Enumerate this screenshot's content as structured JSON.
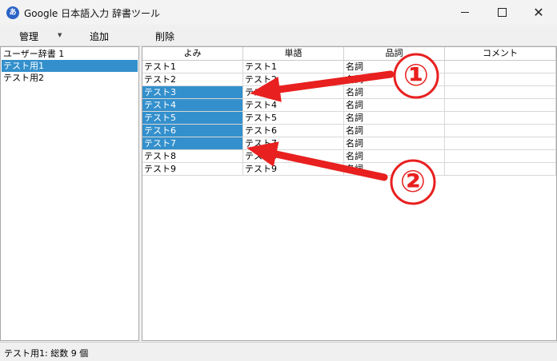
{
  "window": {
    "title": "Google 日本語入力 辞書ツール",
    "icon_label": "あ"
  },
  "menu": {
    "manage": "管理",
    "add": "追加",
    "delete": "削除"
  },
  "dictionaries": [
    {
      "label": "ユーザー辞書 1",
      "selected": false
    },
    {
      "label": "テスト用1",
      "selected": true
    },
    {
      "label": "テスト用2",
      "selected": false
    }
  ],
  "table": {
    "columns": [
      "よみ",
      "単語",
      "品詞",
      "コメント"
    ],
    "rows": [
      {
        "reading": "テスト1",
        "word": "テスト1",
        "pos": "名詞",
        "comment": "",
        "selected": false
      },
      {
        "reading": "テスト2",
        "word": "テスト2",
        "pos": "名詞",
        "comment": "",
        "selected": false
      },
      {
        "reading": "テスト3",
        "word": "テスト3",
        "pos": "名詞",
        "comment": "",
        "selected": true
      },
      {
        "reading": "テスト4",
        "word": "テスト4",
        "pos": "名詞",
        "comment": "",
        "selected": true
      },
      {
        "reading": "テスト5",
        "word": "テスト5",
        "pos": "名詞",
        "comment": "",
        "selected": true
      },
      {
        "reading": "テスト6",
        "word": "テスト6",
        "pos": "名詞",
        "comment": "",
        "selected": true
      },
      {
        "reading": "テスト7",
        "word": "テスト7",
        "pos": "名詞",
        "comment": "",
        "selected": true
      },
      {
        "reading": "テスト8",
        "word": "テスト8",
        "pos": "名詞",
        "comment": "",
        "selected": false
      },
      {
        "reading": "テスト9",
        "word": "テスト9",
        "pos": "名詞",
        "comment": "",
        "selected": false
      }
    ]
  },
  "status": {
    "text": "テスト用1: 総数 9 個"
  },
  "annotations": {
    "color": "#e8201f",
    "markers": [
      "①",
      "②"
    ]
  }
}
